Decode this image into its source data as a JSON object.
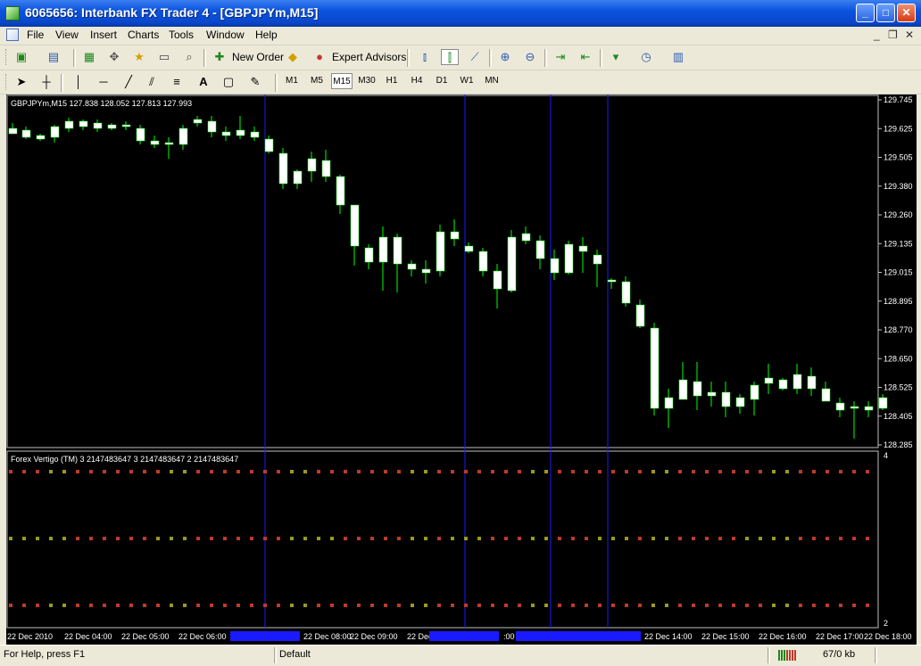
{
  "window": {
    "title": "6065656: Interbank FX Trader 4 - [GBPJPYm,M15]",
    "minimize": "_",
    "maximize": "□",
    "close": "✕"
  },
  "menu": {
    "items": [
      "File",
      "View",
      "Insert",
      "Charts",
      "Tools",
      "Window",
      "Help"
    ],
    "mdi": [
      "_",
      "❐",
      "✕"
    ]
  },
  "toolbar": {
    "new_order": "New Order",
    "expert_advisors": "Expert Advisors",
    "text_tool": "A",
    "timeframes": [
      "M1",
      "M5",
      "M15",
      "M30",
      "H1",
      "H4",
      "D1",
      "W1",
      "MN"
    ],
    "active_timeframe": "M15"
  },
  "chart": {
    "header": "GBPJPYm,M15  127.838 128.052 127.813 127.993",
    "price_ticks": [
      "129.745",
      "129.625",
      "129.505",
      "129.380",
      "129.260",
      "129.135",
      "129.015",
      "128.895",
      "128.770",
      "128.650",
      "128.525",
      "128.405",
      "128.285"
    ],
    "time_labels": [
      "22 Dec 2010",
      "22 Dec 04:00",
      "22 Dec 05:00",
      "22 Dec 06:00",
      "22 Dec 08:00",
      "22 Dec 09:00",
      "22 Dec",
      ":00",
      "22 Dec 14:00",
      "22 Dec 15:00",
      "22 Dec 16:00",
      "22 Dec 17:00",
      "22 Dec 18:00"
    ],
    "indicator_header": "Forex Vertigo (TM) 3 2147483647 3 2147483647 2 2147483647",
    "indicator_scale_top": "4",
    "indicator_scale_bottom": "2",
    "colors": {
      "background": "#000000",
      "bull_candle": "#ffffff",
      "bear_candle": "#ffffff",
      "wick": "#00ff00",
      "vline": "#1a1aff",
      "dot_red": "#c0392b",
      "dot_olive": "#9a9a1a",
      "axis_text": "#ffffff"
    }
  },
  "status": {
    "help": "For Help, press F1",
    "profile": "Default",
    "traffic": "67/0 kb"
  }
}
